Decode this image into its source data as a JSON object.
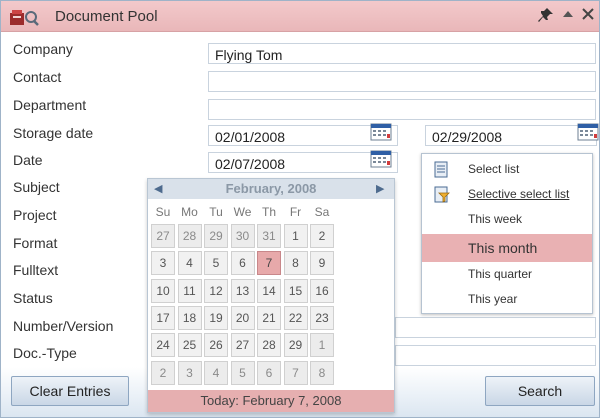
{
  "window": {
    "title": "Document Pool"
  },
  "fields": [
    {
      "label": "Company",
      "value": "Flying Tom"
    },
    {
      "label": "Contact",
      "value": ""
    },
    {
      "label": "Department",
      "value": ""
    },
    {
      "label": "Storage date",
      "value": "02/01/2008",
      "value2": "02/29/2008"
    },
    {
      "label": "Date",
      "value": "02/07/2008"
    },
    {
      "label": "Subject"
    },
    {
      "label": "Project"
    },
    {
      "label": "Format"
    },
    {
      "label": "Fulltext"
    },
    {
      "label": "Status"
    },
    {
      "label": "Number/Version"
    },
    {
      "label": "Doc.-Type"
    }
  ],
  "calendar": {
    "month_label": "February, 2008",
    "weekdays": [
      "Su",
      "Mo",
      "Tu",
      "We",
      "Th",
      "Fr",
      "Sa"
    ],
    "weeks": [
      [
        "27",
        "28",
        "29",
        "30",
        "31",
        "1",
        "2"
      ],
      [
        "3",
        "4",
        "5",
        "6",
        "7",
        "8",
        "9"
      ],
      [
        "10",
        "11",
        "12",
        "13",
        "14",
        "15",
        "16"
      ],
      [
        "17",
        "18",
        "19",
        "20",
        "21",
        "22",
        "23"
      ],
      [
        "24",
        "25",
        "26",
        "27",
        "28",
        "29",
        "1"
      ],
      [
        "2",
        "3",
        "4",
        "5",
        "6",
        "7",
        "8"
      ]
    ],
    "selected_day": "7",
    "today_label": "Today: February 7, 2008"
  },
  "date_menu": {
    "items": [
      {
        "label": "Select list",
        "icon": "list-icon"
      },
      {
        "label": "Selective select list",
        "icon": "filter-list-icon"
      },
      {
        "label": "This week"
      },
      {
        "label": "This month",
        "active": true
      },
      {
        "label": "This quarter"
      },
      {
        "label": "This year"
      }
    ]
  },
  "buttons": {
    "clear": "Clear Entries",
    "search": "Search"
  },
  "colors": {
    "title_bar": "#ebbcbe",
    "highlight": "#e7a9aa",
    "calendar_header": "#d9e1ea"
  }
}
